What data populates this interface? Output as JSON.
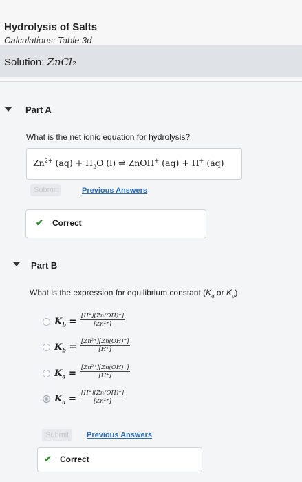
{
  "header": {
    "title": "Hydrolysis of Salts",
    "subtitle": "Calculations: Table 3d",
    "solution_label": "Solution:",
    "solution_formula": "ZnCl₂"
  },
  "part_a": {
    "title": "Part A",
    "question": "What is the net ionic equation for hydrolysis?",
    "answer": {
      "ion": "Zn",
      "ion_charge": "2+",
      "t1": " (aq) + H",
      "h2o_sub": "2",
      "t2": "O (l) ⇌ ZnOH",
      "znoh_charge": "+",
      "t3": " (aq) + H",
      "h_charge": "+",
      "t4": " (aq)"
    },
    "submit_label": "Submit",
    "previous_answers_label": "Previous Answers",
    "feedback": "Correct"
  },
  "part_b": {
    "title": "Part B",
    "question_prefix": "What is the expression for equilibrium constant (",
    "ka": "K",
    "ka_sub": "a",
    "question_or": " or ",
    "kb": "K",
    "kb_sub": "b",
    "question_suffix": ")",
    "options": [
      {
        "symbol": "K",
        "sub": "b",
        "eq": " =",
        "numerator": "[H⁺][Zn(OH)⁺]",
        "denominator": "[Zn²⁺]",
        "selected": false
      },
      {
        "symbol": "K",
        "sub": "b",
        "eq": " =",
        "numerator": "[Zn²⁺][Zn(OH)⁺]",
        "denominator": "[H⁺]",
        "selected": false
      },
      {
        "symbol": "K",
        "sub": "a",
        "eq": " =",
        "numerator": "[Zn²⁺][Zn(OH)⁺]",
        "denominator": "[H⁺]",
        "selected": false
      },
      {
        "symbol": "K",
        "sub": "a",
        "eq": " =",
        "numerator": "[H⁺][Zn(OH)⁺]",
        "denominator": "[Zn²⁺]",
        "selected": true
      }
    ],
    "submit_label": "Submit",
    "previous_answers_label": "Previous Answers",
    "feedback": "Correct"
  },
  "icons": {
    "caret": "caret-down-icon",
    "check": "checkmark-icon"
  },
  "colors": {
    "correct_green": "#2f8f2f",
    "link_blue": "#2a6db3"
  }
}
